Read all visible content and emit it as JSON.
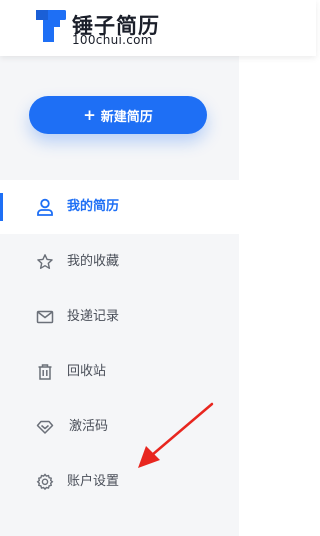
{
  "brand": {
    "name": "锤子简历",
    "domain": "100chui.com",
    "logo_icon": "hammer-logo-icon",
    "accent": "#1e6ff5"
  },
  "new_button": {
    "plus": "+",
    "label": "新建简历"
  },
  "menu": [
    {
      "label": "我的简历",
      "icon": "user-icon",
      "active": true
    },
    {
      "label": "我的收藏",
      "icon": "star-icon",
      "active": false
    },
    {
      "label": "投递记录",
      "icon": "mail-icon",
      "active": false
    },
    {
      "label": "回收站",
      "icon": "trash-icon",
      "active": false
    },
    {
      "label": "激活码",
      "icon": "diamond-icon",
      "active": false
    },
    {
      "label": "账户设置",
      "icon": "gear-icon",
      "active": false
    }
  ],
  "annotation": {
    "type": "red-arrow",
    "color": "#e8261f"
  }
}
